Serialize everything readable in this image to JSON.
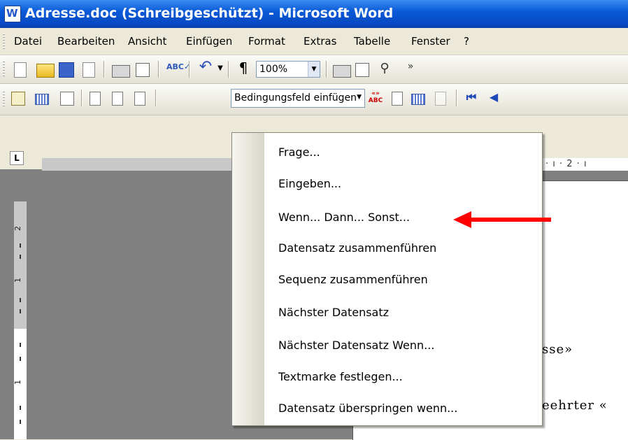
{
  "window": {
    "title": "Adresse.doc (Schreibgeschützt) - Microsoft Word"
  },
  "menubar": {
    "items": [
      {
        "label": "Datei"
      },
      {
        "label": "Bearbeiten"
      },
      {
        "label": "Ansicht"
      },
      {
        "label": "Einfügen"
      },
      {
        "label": "Format"
      },
      {
        "label": "Extras"
      },
      {
        "label": "Tabelle"
      },
      {
        "label": "Fenster"
      },
      {
        "label": "?"
      }
    ]
  },
  "standard_toolbar": {
    "zoom": "100%",
    "icons": [
      "new-document-icon",
      "open-folder-icon",
      "save-icon",
      "permission-icon",
      "print-icon",
      "print-preview-icon",
      "spelling-icon",
      "undo-icon",
      "undo-dropdown-icon",
      "paragraph-mark-icon",
      "print-icon",
      "mail-icon",
      "find-icon",
      "toolbar-options-icon"
    ]
  },
  "mailmerge_toolbar": {
    "field_button": "Bedingungsfeld einfügen",
    "abc_icon": "«» ABC"
  },
  "ruler": {
    "corner": "L",
    "text": "· ı · 2 · ı",
    "vertical_numbers": [
      "2",
      "1",
      "1"
    ]
  },
  "document": {
    "line1": "sse»",
    "line2": "eehrter «"
  },
  "menu": {
    "items": [
      {
        "label": "Frage..."
      },
      {
        "label": "Eingeben..."
      },
      {
        "label": "Wenn... Dann... Sonst..."
      },
      {
        "label": "Datensatz zusammenführen"
      },
      {
        "label": "Sequenz zusammenführen"
      },
      {
        "label": "Nächster Datensatz"
      },
      {
        "label": "Nächster Datensatz Wenn..."
      },
      {
        "label": "Textmarke festlegen..."
      },
      {
        "label": "Datensatz überspringen wenn..."
      }
    ]
  },
  "colors": {
    "title_bar": "#0a5ad8",
    "annotation_arrow": "#ff0000"
  }
}
